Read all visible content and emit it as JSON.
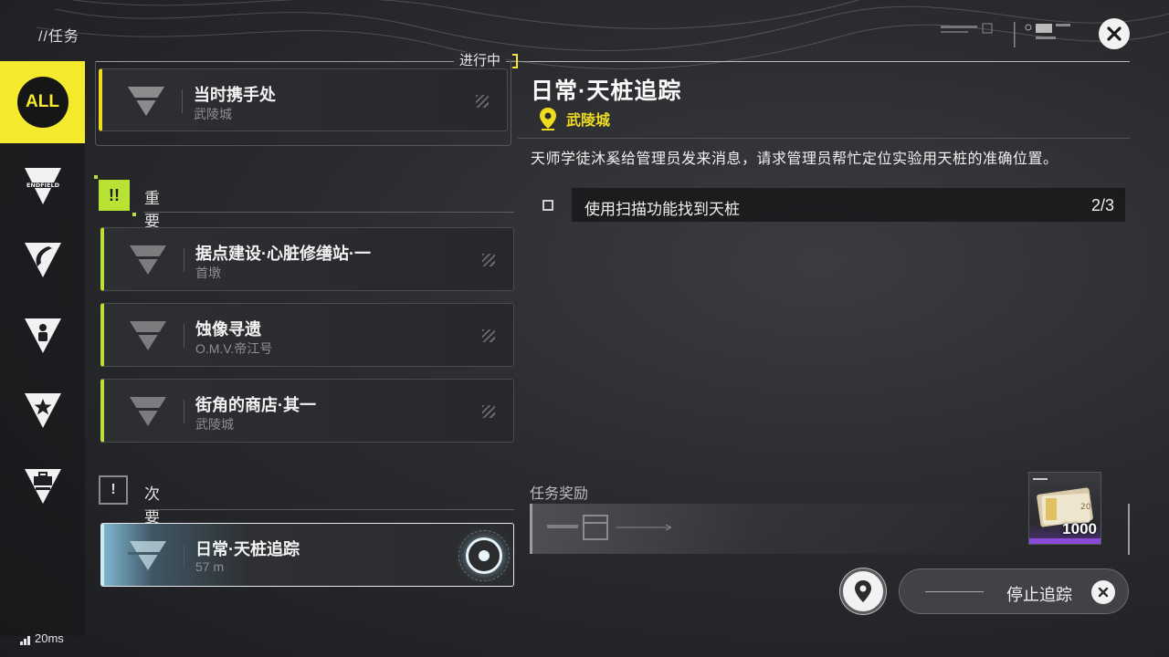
{
  "header": {
    "title": "//任务",
    "close_icon": "close-icon",
    "status_tag": "进行中"
  },
  "categories": [
    {
      "id": "all",
      "label": "ALL",
      "active": true,
      "icon": "all-badge-icon"
    },
    {
      "id": "endfield",
      "label": "ENDFIELD",
      "active": false,
      "icon": "endfield-emblem-icon"
    },
    {
      "id": "blade",
      "label": "",
      "active": false,
      "icon": "blade-emblem-icon"
    },
    {
      "id": "person",
      "label": "",
      "active": false,
      "icon": "person-emblem-icon"
    },
    {
      "id": "star",
      "label": "",
      "active": false,
      "icon": "star-emblem-icon"
    },
    {
      "id": "briefcase",
      "label": "",
      "active": false,
      "icon": "briefcase-emblem-icon"
    }
  ],
  "in_progress": {
    "name": "当时携手处",
    "location": "武陵城"
  },
  "important": {
    "label": "重要",
    "icon": "double-exclamation-icon",
    "quests": [
      {
        "name": "据点建设·心脏修缮站·一",
        "location": "首墩"
      },
      {
        "name": "蚀像寻遗",
        "location": "O.M.V.帝江号"
      },
      {
        "name": "街角的商店·其一",
        "location": "武陵城"
      }
    ]
  },
  "minor": {
    "label": "次要",
    "icon": "exclamation-icon",
    "quests": [
      {
        "name": "日常·天桩追踪",
        "location": "57 m",
        "tracked": true
      }
    ]
  },
  "detail": {
    "title": "日常·天桩追踪",
    "location": "武陵城",
    "description": "天师学徒沐奚给管理员发来消息，请求管理员帮忙定位实验用天桩的准确位置。",
    "objective": {
      "text": "使用扫描功能找到天桩",
      "progress": "2/3"
    },
    "reward_label": "任务奖励",
    "reward_item": {
      "count": "1000",
      "icon": "currency-bundle-icon"
    }
  },
  "actions": {
    "map_icon": "map-pin-icon",
    "stop_tracking_label": "停止追踪"
  },
  "status": {
    "ping": "20ms"
  },
  "colors": {
    "accent_yellow": "#f5ea2d",
    "important_green": "#b8e335",
    "location_yellow": "#f0dc1f",
    "rarity_purple": "#8a4bd8"
  }
}
